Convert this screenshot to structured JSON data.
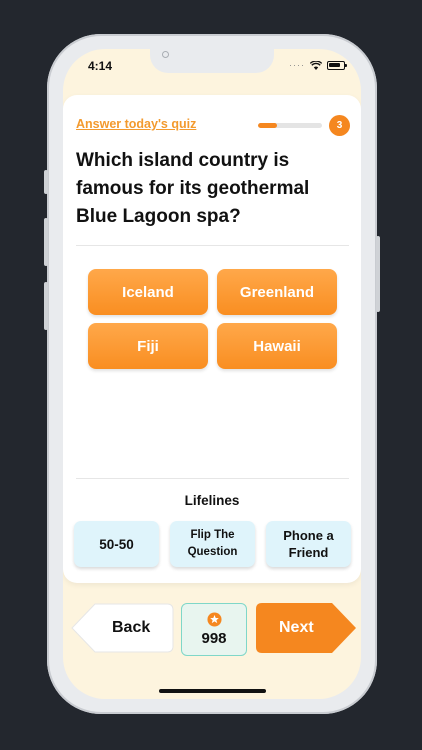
{
  "status_bar": {
    "time": "4:14"
  },
  "quiz": {
    "link_label": "Answer today's quiz",
    "progress_fraction": 0.3,
    "step": "3",
    "question": "Which island country is famous for its geothermal Blue Lagoon spa?",
    "answers": [
      {
        "label": "Iceland"
      },
      {
        "label": "Greenland"
      },
      {
        "label": "Fiji"
      },
      {
        "label": "Hawaii"
      }
    ]
  },
  "lifelines": {
    "title": "Lifelines",
    "items": [
      {
        "label": "50-50"
      },
      {
        "label": "Flip The Question"
      },
      {
        "label": "Phone a Friend"
      }
    ]
  },
  "nav": {
    "back_label": "Back",
    "next_label": "Next",
    "points": "998",
    "points_icon": "star-icon"
  },
  "colors": {
    "accent": "#f5871f",
    "background": "#fdf4de",
    "lifeline_bg": "#dff4fb",
    "points_border": "#7fd7c8"
  }
}
